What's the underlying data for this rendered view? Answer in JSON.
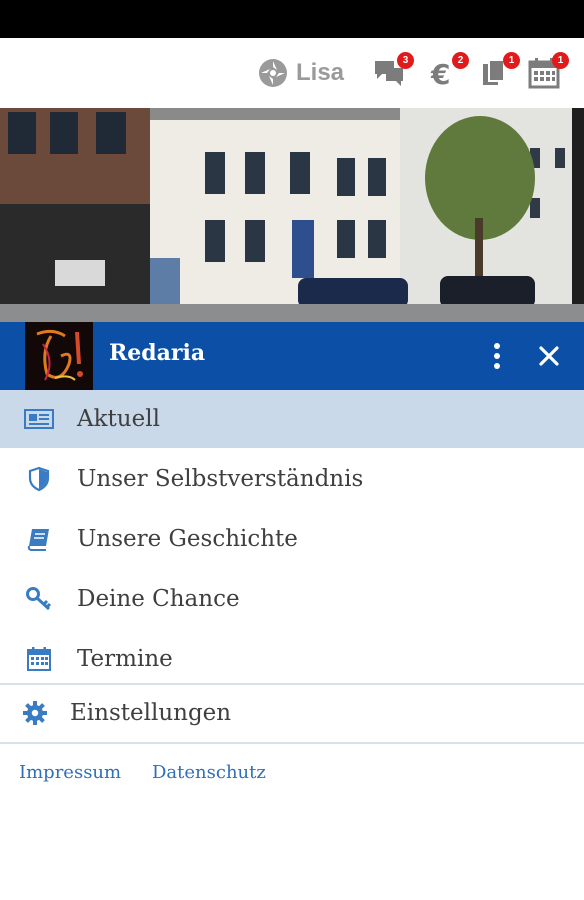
{
  "header": {
    "user_name": "Lisa",
    "badges": {
      "messages": "3",
      "payments": "2",
      "documents": "1",
      "calendar": "1"
    }
  },
  "brand": {
    "name": "Redaria"
  },
  "nav": {
    "items": [
      {
        "label": "Aktuell",
        "icon": "newspaper-icon",
        "active": true
      },
      {
        "label": "Unser Selbstverständnis",
        "icon": "shield-icon"
      },
      {
        "label": "Unsere Geschichte",
        "icon": "book-icon"
      },
      {
        "label": "Deine Chance",
        "icon": "key-icon"
      },
      {
        "label": "Termine",
        "icon": "calendar-icon"
      }
    ],
    "settings_label": "Einstellungen"
  },
  "footer": {
    "impressum": "Impressum",
    "datenschutz": "Datenschutz"
  },
  "colors": {
    "brand_blue": "#0b4fa6",
    "active_row": "#c9d9ea",
    "icon_blue": "#3a7cc4",
    "badge_red": "#e11b1b",
    "link_blue": "#2f6fb7"
  }
}
